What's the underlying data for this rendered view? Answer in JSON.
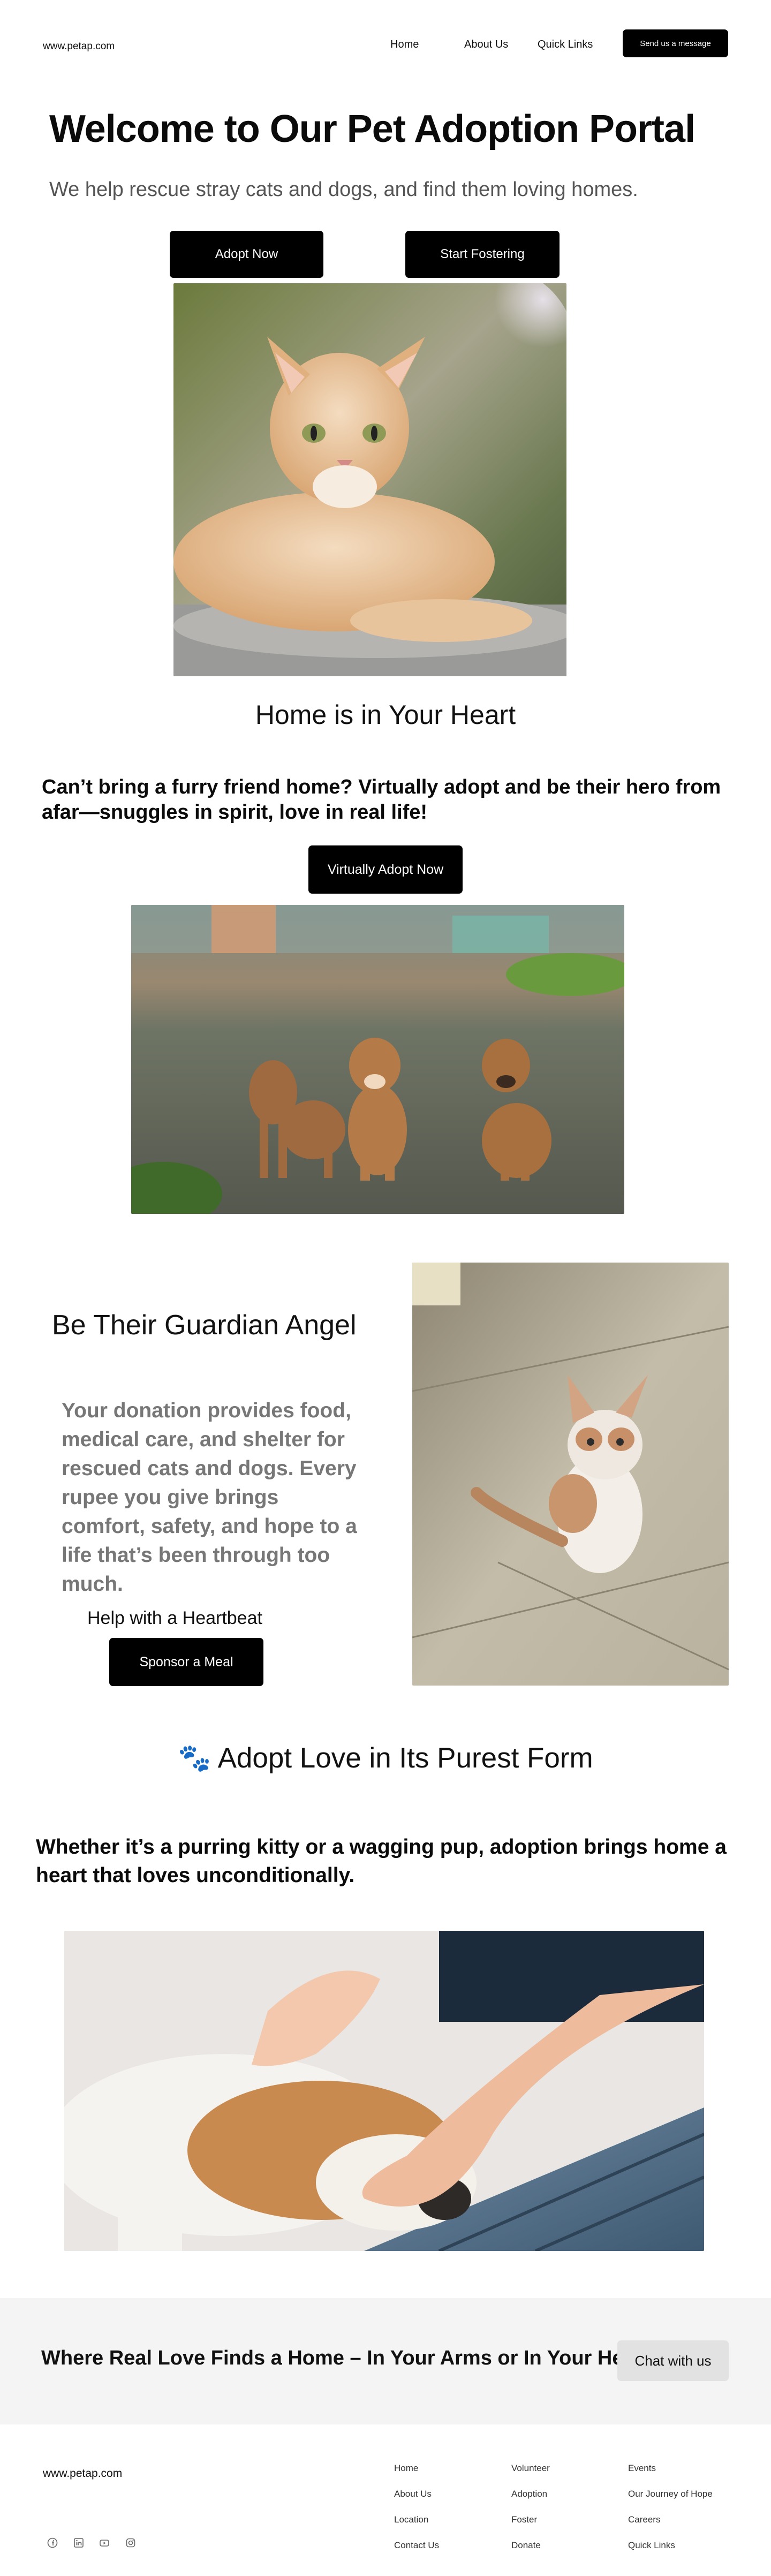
{
  "header": {
    "site": "www.petap.com",
    "nav": [
      "Home",
      "About Us",
      "Quick Links"
    ],
    "message_button": "Send us a message"
  },
  "hero": {
    "title": "Welcome to Our Pet Adoption Portal",
    "subtitle": "We help rescue stray cats and dogs, and find them loving homes.",
    "adopt_button": "Adopt Now",
    "foster_button": "Start Fostering"
  },
  "home_section": {
    "title": "Home is in Your Heart",
    "text": "Can’t bring a furry friend home? Virtually adopt and be their hero from afar—snuggles in spirit, love in real life!",
    "button": "Virtually Adopt Now"
  },
  "guardian": {
    "title": "Be Their Guardian Angel",
    "text": "Your donation provides food, medical care, and shelter for rescued cats and dogs. Every rupee you give brings comfort, safety, and hope to a life that’s been through too much.",
    "heartbeat_label": "Help with a Heartbeat",
    "sponsor_button": "Sponsor a Meal"
  },
  "adopt_love": {
    "emoji": "🐾",
    "title": "Adopt Love in Its Purest Form",
    "text": "Whether it’s a purring kitty or a wagging pup, adoption brings home a heart that loves unconditionally."
  },
  "cta": {
    "text": "Where Real Love Finds a Home – In Your Arms or In Your Heart.",
    "button": "Chat with us"
  },
  "footer": {
    "site": "www.petap.com",
    "col1": [
      "Home",
      "About Us",
      "Location",
      "Contact Us"
    ],
    "col2": [
      "Volunteer",
      "Adoption",
      "Foster",
      "Donate"
    ],
    "col3": [
      "Events",
      "Our Journey of Hope",
      "Careers",
      "Quick Links"
    ],
    "social_icons": [
      "facebook-icon",
      "linkedin-icon",
      "youtube-icon",
      "instagram-icon"
    ]
  }
}
